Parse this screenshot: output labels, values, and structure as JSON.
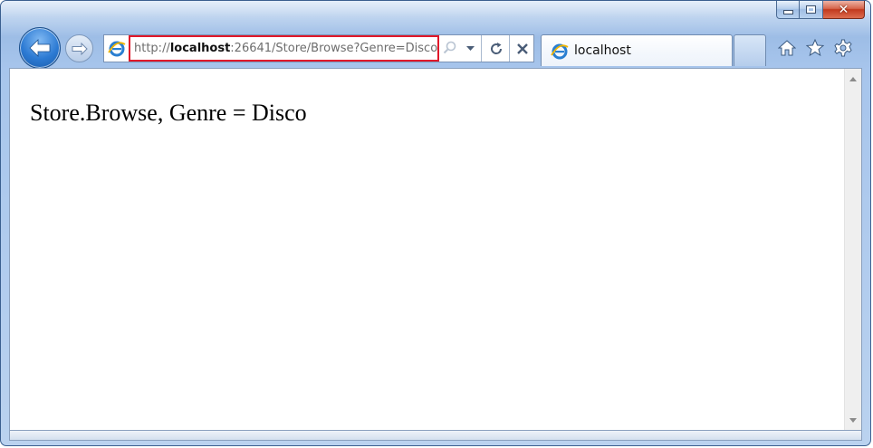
{
  "window": {
    "caption_buttons": [
      "minimize",
      "maximize",
      "close"
    ]
  },
  "navigation": {
    "back_icon": "back-arrow-icon",
    "forward_icon": "forward-arrow-icon"
  },
  "address_bar": {
    "url_prefix": "http://",
    "url_host": "localhost",
    "url_rest": ":26641/Store/Browse?Genre=Disco",
    "highlight_color": "#e0182a"
  },
  "tabs": [
    {
      "title": "localhost",
      "active": true
    }
  ],
  "toolbar_icons": [
    "home-icon",
    "favorites-star-icon",
    "tools-gear-icon"
  ],
  "page": {
    "body_text": "Store.Browse, Genre = Disco"
  },
  "colors": {
    "frame": "#9dbde6",
    "back_button": "#2c7ad3",
    "close_button": "#c1391d"
  }
}
